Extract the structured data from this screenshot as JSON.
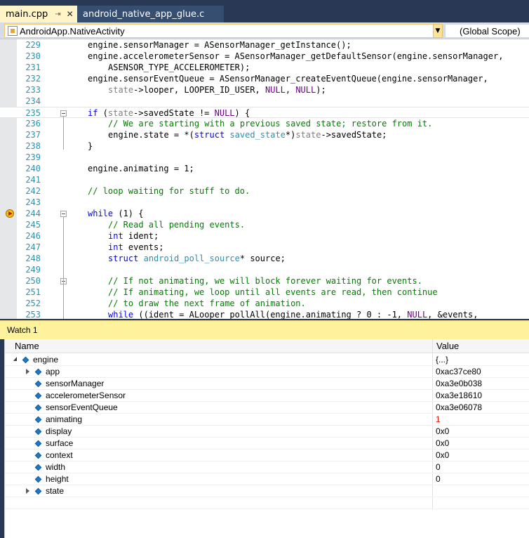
{
  "tabs": [
    {
      "label": "main.cpp",
      "active": true
    },
    {
      "label": "android_native_app_glue.c",
      "active": false
    }
  ],
  "nav": {
    "left_combo": "AndroidApp.NativeActivity",
    "right_combo": "(Global Scope)"
  },
  "editor": {
    "lines": [
      {
        "n": "229",
        "segs": [
          {
            "t": "engine.sensorManager = ASensorManager_getInstance();",
            "c": ""
          }
        ]
      },
      {
        "n": "230",
        "segs": [
          {
            "t": "engine.accelerometerSensor = ASensorManager_getDefaultSensor(engine.sensorManager,",
            "c": ""
          }
        ]
      },
      {
        "n": "231",
        "indent": 1,
        "segs": [
          {
            "t": "ASENSOR_TYPE_ACCELEROMETER);",
            "c": ""
          }
        ]
      },
      {
        "n": "232",
        "segs": [
          {
            "t": "engine.sensorEventQueue = ASensorManager_createEventQueue(engine.sensorManager,",
            "c": ""
          }
        ]
      },
      {
        "n": "233",
        "indent": 1,
        "segs": [
          {
            "t": "state",
            "c": "pr"
          },
          {
            "t": "->looper, LOOPER_ID_USER, ",
            "c": ""
          },
          {
            "t": "NULL",
            "c": "mc"
          },
          {
            "t": ", ",
            "c": ""
          },
          {
            "t": "NULL",
            "c": "mc"
          },
          {
            "t": ");",
            "c": ""
          }
        ]
      },
      {
        "n": "234",
        "segs": []
      },
      {
        "n": "235",
        "fold": true,
        "hl": true,
        "segs": [
          {
            "t": "if",
            "c": "kw"
          },
          {
            "t": " (",
            "c": ""
          },
          {
            "t": "state",
            "c": "pr"
          },
          {
            "t": "->savedState != ",
            "c": ""
          },
          {
            "t": "NULL",
            "c": "mc"
          },
          {
            "t": ") {",
            "c": ""
          }
        ]
      },
      {
        "n": "236",
        "indent": 1,
        "segs": [
          {
            "t": "// We are starting with a previous saved state; restore from it.",
            "c": "cm"
          }
        ]
      },
      {
        "n": "237",
        "indent": 1,
        "segs": [
          {
            "t": "engine.state = *(",
            "c": ""
          },
          {
            "t": "struct",
            "c": "kw"
          },
          {
            "t": " ",
            "c": ""
          },
          {
            "t": "saved_state",
            "c": "ty"
          },
          {
            "t": "*)",
            "c": ""
          },
          {
            "t": "state",
            "c": "pr"
          },
          {
            "t": "->savedState;",
            "c": ""
          }
        ]
      },
      {
        "n": "238",
        "segs": [
          {
            "t": "}",
            "c": ""
          }
        ]
      },
      {
        "n": "239",
        "segs": []
      },
      {
        "n": "240",
        "segs": [
          {
            "t": "engine.animating = 1;",
            "c": ""
          }
        ]
      },
      {
        "n": "241",
        "segs": []
      },
      {
        "n": "242",
        "segs": [
          {
            "t": "// loop waiting for stuff to do.",
            "c": "cm"
          }
        ]
      },
      {
        "n": "243",
        "segs": []
      },
      {
        "n": "244",
        "fold": true,
        "bp": true,
        "segs": [
          {
            "t": "while",
            "c": "kw"
          },
          {
            "t": " (1) {",
            "c": ""
          }
        ]
      },
      {
        "n": "245",
        "indent": 1,
        "segs": [
          {
            "t": "// Read all pending events.",
            "c": "cm"
          }
        ]
      },
      {
        "n": "246",
        "indent": 1,
        "segs": [
          {
            "t": "int",
            "c": "kw"
          },
          {
            "t": " ident;",
            "c": ""
          }
        ]
      },
      {
        "n": "247",
        "indent": 1,
        "segs": [
          {
            "t": "int",
            "c": "kw"
          },
          {
            "t": " events;",
            "c": ""
          }
        ]
      },
      {
        "n": "248",
        "indent": 1,
        "segs": [
          {
            "t": "struct",
            "c": "kw"
          },
          {
            "t": " ",
            "c": ""
          },
          {
            "t": "android_poll_source",
            "c": "ty"
          },
          {
            "t": "* source;",
            "c": ""
          }
        ]
      },
      {
        "n": "249",
        "segs": []
      },
      {
        "n": "250",
        "fold": true,
        "indent": 1,
        "segs": [
          {
            "t": "// If not animating, we will block forever waiting for events.",
            "c": "cm"
          }
        ]
      },
      {
        "n": "251",
        "indent": 1,
        "segs": [
          {
            "t": "// If animating, we loop until all events are read, then continue",
            "c": "cm"
          }
        ]
      },
      {
        "n": "252",
        "indent": 1,
        "segs": [
          {
            "t": "// to draw the next frame of animation.",
            "c": "cm"
          }
        ]
      },
      {
        "n": "253",
        "indent": 1,
        "segs": [
          {
            "t": "while",
            "c": "kw"
          },
          {
            "t": " ((ident = ALooper_pollAll(engine.animating ? 0 : -1, ",
            "c": ""
          },
          {
            "t": "NULL",
            "c": "mc"
          },
          {
            "t": ", &events,",
            "c": ""
          }
        ]
      }
    ]
  },
  "watch": {
    "title": "Watch 1",
    "col_name": "Name",
    "col_value": "Value",
    "rows": [
      {
        "name": "engine",
        "value": "{...}",
        "level": 0,
        "expander": "open"
      },
      {
        "name": "app",
        "value": "0xac37ce80",
        "level": 1,
        "expander": "closed"
      },
      {
        "name": "sensorManager",
        "value": "0xa3e0b038",
        "level": 1,
        "expander": "none"
      },
      {
        "name": "accelerometerSensor",
        "value": "0xa3e18610",
        "level": 1,
        "expander": "none"
      },
      {
        "name": "sensorEventQueue",
        "value": "0xa3e06078",
        "level": 1,
        "expander": "none"
      },
      {
        "name": "animating",
        "value": "1",
        "level": 1,
        "expander": "none",
        "changed": true
      },
      {
        "name": "display",
        "value": "0x0",
        "level": 1,
        "expander": "none"
      },
      {
        "name": "surface",
        "value": "0x0",
        "level": 1,
        "expander": "none"
      },
      {
        "name": "context",
        "value": "0x0",
        "level": 1,
        "expander": "none"
      },
      {
        "name": "width",
        "value": "0",
        "level": 1,
        "expander": "none"
      },
      {
        "name": "height",
        "value": "0",
        "level": 1,
        "expander": "none"
      },
      {
        "name": "state",
        "value": "",
        "level": 1,
        "expander": "closed"
      }
    ]
  },
  "icons": {
    "tab_pin": "pin-icon",
    "tab_close": "close-icon",
    "nav_class": "class-icon",
    "dropdown": "chevron-down-icon",
    "breakpoint": "breakpoint-current-statement-icon",
    "watch_object": "object-variable-icon"
  }
}
